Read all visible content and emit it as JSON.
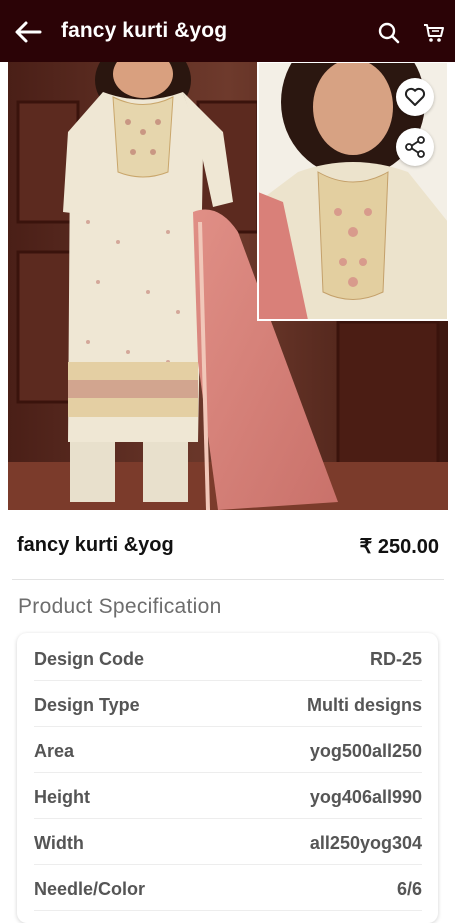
{
  "app_bar": {
    "title": "fancy kurti &yog",
    "icons": [
      "back-arrow-icon",
      "search-icon",
      "cart-icon"
    ]
  },
  "product_image": {
    "actions": [
      "heart-icon",
      "share-icon"
    ]
  },
  "product": {
    "name": "fancy kurti &yog",
    "price": "₹ 250.00"
  },
  "specification": {
    "heading": "Product Specification",
    "rows": [
      {
        "key": "Design Code",
        "value": "RD-25"
      },
      {
        "key": "Design Type",
        "value": "Multi designs"
      },
      {
        "key": "Area",
        "value": "yog500all250"
      },
      {
        "key": "Height",
        "value": "yog406all990"
      },
      {
        "key": "Width",
        "value": "all250yog304"
      },
      {
        "key": "Needle/Color",
        "value": "6/6"
      }
    ]
  },
  "colors": {
    "app_bar": "#2b0306",
    "text_primary": "#111111",
    "text_secondary": "#555555",
    "heading_gray": "#6d6d6d"
  }
}
